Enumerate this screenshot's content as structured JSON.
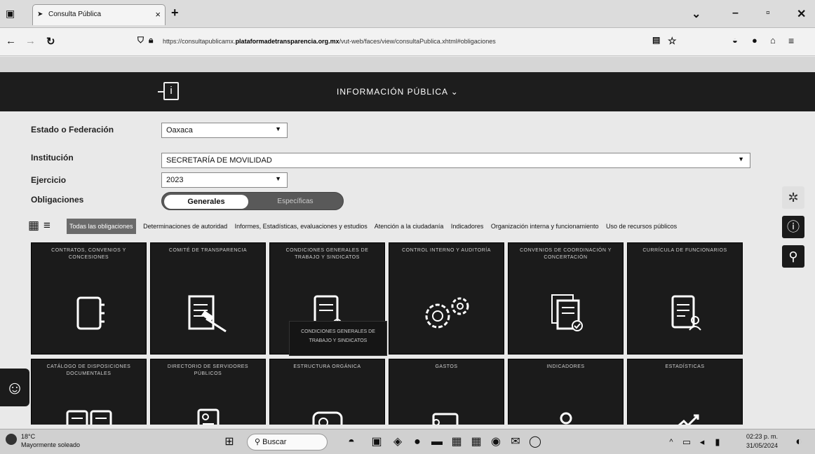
{
  "browser": {
    "tab_title": "Consulta Pública",
    "url_prefix": "https://consultapublicamx.",
    "url_domain": "plataformadetransparencia.org.mx",
    "url_suffix": "/vut-web/faces/view/consultaPublica.xhtml#obligaciones"
  },
  "header": {
    "menu_label": "INFORMACIÓN PÚBLICA ⌄"
  },
  "filters": {
    "state_label": "Estado o Federación",
    "state_value": "Oaxaca",
    "institution_label": "Institución",
    "institution_value": "SECRETARÍA DE MOVILIDAD",
    "year_label": "Ejercicio",
    "year_value": "2023",
    "obligations_label": "Obligaciones",
    "toggle_on": "Generales",
    "toggle_off": "Específicas"
  },
  "categories": [
    "Todas las obligaciones",
    "Determinaciones de autoridad",
    "Informes, Estadísticas, evaluaciones y estudios",
    "Atención a la ciudadanía",
    "Indicadores",
    "Organización interna y funcionamiento",
    "Uso de recursos públicos"
  ],
  "tiles": [
    {
      "title": "CONTRATOS, CONVENIOS Y CONCESIONES",
      "icon": "notebook-icon"
    },
    {
      "title": "COMITÉ DE TRANSPARENCIA",
      "icon": "document-gavel-icon"
    },
    {
      "title": "CONDICIONES GENERALES DE TRABAJO Y SINDICATOS",
      "icon": "document-user-icon"
    },
    {
      "title": "CONTROL INTERNO Y AUDITORÍA",
      "icon": "gears-icon"
    },
    {
      "title": "CONVENIOS DE COORDINACIÓN Y CONCERTACIÓN",
      "icon": "documents-check-icon"
    },
    {
      "title": "CURRÍCULA DE FUNCIONARIOS",
      "icon": "resume-icon"
    },
    {
      "title": "CATÁLOGO DE DISPOSICIONES DOCUMENTALES",
      "icon": "folders-icon"
    },
    {
      "title": "DIRECTORIO DE SERVIDORES PÚBLICOS",
      "icon": "id-card-icon"
    },
    {
      "title": "ESTRUCTURA ORGÁNICA",
      "icon": "org-chart-icon"
    },
    {
      "title": "GASTOS",
      "icon": "money-icon"
    },
    {
      "title": "INDICADORES",
      "icon": "people-icon"
    },
    {
      "title": "ESTADÍSTICAS",
      "icon": "trend-icon"
    }
  ],
  "popup_text": "CONDICIONES GENERALES DE TRABAJO Y SINDICATOS",
  "taskbar": {
    "weather_temp": "18°C",
    "weather_desc": "Mayormente soleado",
    "search_label": "Buscar",
    "time": "02:23 p. m.",
    "date": "31/05/2024"
  }
}
